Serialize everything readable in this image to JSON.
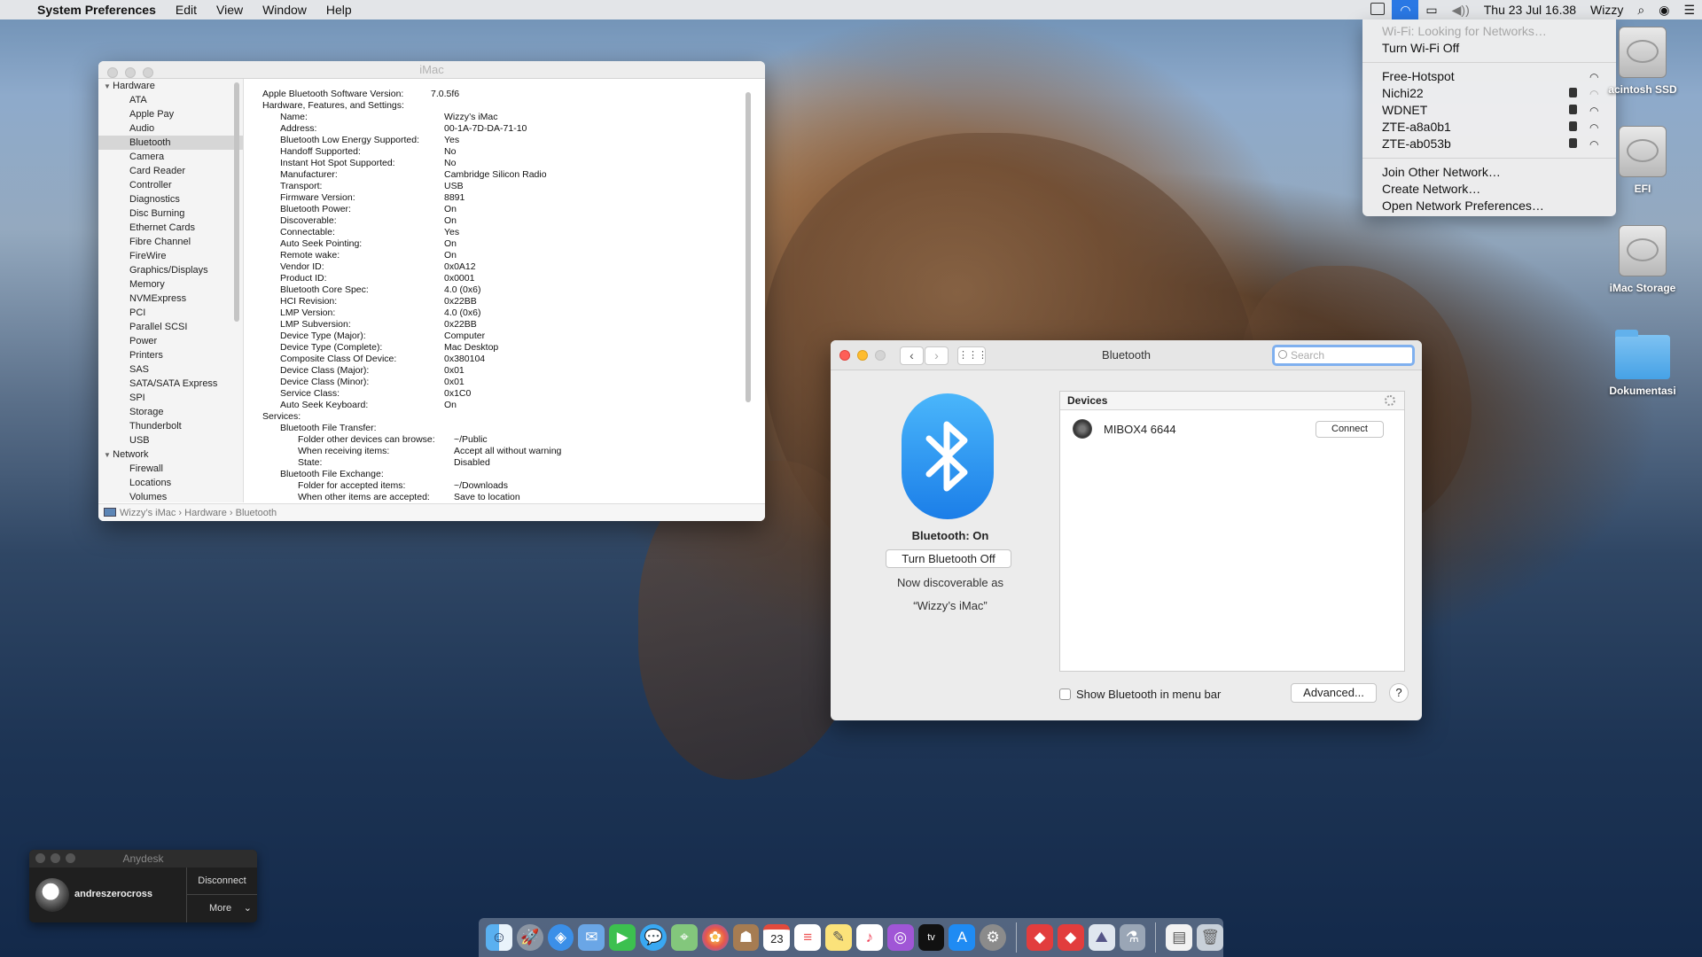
{
  "menubar": {
    "app_name": "System Preferences",
    "menus": [
      "Edit",
      "View",
      "Window",
      "Help"
    ],
    "clock": "Thu 23 Jul  16.38",
    "user": "Wizzy"
  },
  "wifi_menu": {
    "status": "Wi-Fi: Looking for Networks…",
    "toggle": "Turn Wi-Fi Off",
    "networks": [
      {
        "name": "Free-Hotspot",
        "locked": false
      },
      {
        "name": "Nichi22",
        "locked": true
      },
      {
        "name": "WDNET",
        "locked": true
      },
      {
        "name": "ZTE-a8a0b1",
        "locked": true
      },
      {
        "name": "ZTE-ab053b",
        "locked": true
      }
    ],
    "actions": [
      "Join Other Network…",
      "Create Network…",
      "Open Network Preferences…"
    ]
  },
  "desktop_icons": [
    "acintosh SSD",
    "EFI",
    "iMac Storage",
    "Dokumentasi"
  ],
  "sysinfo": {
    "title": "iMac",
    "categories": [
      {
        "name": "Hardware",
        "items": [
          "ATA",
          "Apple Pay",
          "Audio",
          "Bluetooth",
          "Camera",
          "Card Reader",
          "Controller",
          "Diagnostics",
          "Disc Burning",
          "Ethernet Cards",
          "Fibre Channel",
          "FireWire",
          "Graphics/Displays",
          "Memory",
          "NVMExpress",
          "PCI",
          "Parallel SCSI",
          "Power",
          "Printers",
          "SAS",
          "SATA/SATA Express",
          "SPI",
          "Storage",
          "Thunderbolt",
          "USB"
        ]
      },
      {
        "name": "Network",
        "items": [
          "Firewall",
          "Locations",
          "Volumes"
        ]
      }
    ],
    "selected": "Bluetooth",
    "content": {
      "version_label": "Apple Bluetooth Software Version:",
      "version": "7.0.5f6",
      "section": "Hardware, Features, and Settings:",
      "rows": [
        [
          "Name:",
          "Wizzy’s iMac"
        ],
        [
          "Address:",
          "00-1A-7D-DA-71-10"
        ],
        [
          "Bluetooth Low Energy Supported:",
          "Yes"
        ],
        [
          "Handoff Supported:",
          "No"
        ],
        [
          "Instant Hot Spot Supported:",
          "No"
        ],
        [
          "Manufacturer:",
          "Cambridge Silicon Radio"
        ],
        [
          "Transport:",
          "USB"
        ],
        [
          "Firmware Version:",
          "8891"
        ],
        [
          "Bluetooth Power:",
          "On"
        ],
        [
          "Discoverable:",
          "On"
        ],
        [
          "Connectable:",
          "Yes"
        ],
        [
          "Auto Seek Pointing:",
          "On"
        ],
        [
          "Remote wake:",
          "On"
        ],
        [
          "Vendor ID:",
          "0x0A12"
        ],
        [
          "Product ID:",
          "0x0001"
        ],
        [
          "Bluetooth Core Spec:",
          "4.0 (0x6)"
        ],
        [
          "HCI Revision:",
          "0x22BB"
        ],
        [
          "LMP Version:",
          "4.0 (0x6)"
        ],
        [
          "LMP Subversion:",
          "0x22BB"
        ],
        [
          "Device Type (Major):",
          "Computer"
        ],
        [
          "Device Type (Complete):",
          "Mac Desktop"
        ],
        [
          "Composite Class Of Device:",
          "0x380104"
        ],
        [
          "Device Class (Major):",
          "0x01"
        ],
        [
          "Device Class (Minor):",
          "0x01"
        ],
        [
          "Service Class:",
          "0x1C0"
        ],
        [
          "Auto Seek Keyboard:",
          "On"
        ]
      ],
      "services_label": "Services:",
      "services": [
        {
          "name": "Bluetooth File Transfer:",
          "rows": [
            [
              "Folder other devices can browse:",
              "~/Public"
            ],
            [
              "When receiving items:",
              "Accept all without warning"
            ],
            [
              "State:",
              "Disabled"
            ]
          ]
        },
        {
          "name": "Bluetooth File Exchange:",
          "rows": [
            [
              "Folder for accepted items:",
              "~/Downloads"
            ],
            [
              "When other items are accepted:",
              "Save to location"
            ]
          ]
        }
      ]
    },
    "path": [
      "Wizzy’s iMac",
      "Hardware",
      "Bluetooth"
    ]
  },
  "bluetooth": {
    "title": "Bluetooth",
    "search_placeholder": "Search",
    "status": "Bluetooth: On",
    "toggle_label": "Turn Bluetooth Off",
    "discoverable_line1": "Now discoverable as",
    "discoverable_line2": "“Wizzy’s iMac”",
    "devices_header": "Devices",
    "devices": [
      {
        "name": "MIBOX4 6644",
        "action": "Connect"
      }
    ],
    "show_in_menubar_label": "Show Bluetooth in menu bar",
    "show_in_menubar": false,
    "advanced_label": "Advanced...",
    "help_label": "?"
  },
  "anydesk": {
    "title": "Anydesk",
    "user": "andreszerocross",
    "disconnect": "Disconnect",
    "more": "More"
  },
  "dock": {
    "apps": [
      "finder-icon",
      "launchpad-icon",
      "safari-icon",
      "mail-icon",
      "facetime-icon",
      "messages-icon",
      "maps-icon",
      "photos-icon",
      "contacts-icon",
      "calendar-icon",
      "reminders-icon",
      "notes-icon",
      "music-icon",
      "podcasts-icon",
      "tv-icon",
      "appstore-icon",
      "system-preferences-icon",
      "anydesk-icon",
      "anydesk-alt-icon",
      "preview-icon",
      "utility-icon"
    ],
    "calendar_day": "23",
    "tv_label": "tv"
  }
}
